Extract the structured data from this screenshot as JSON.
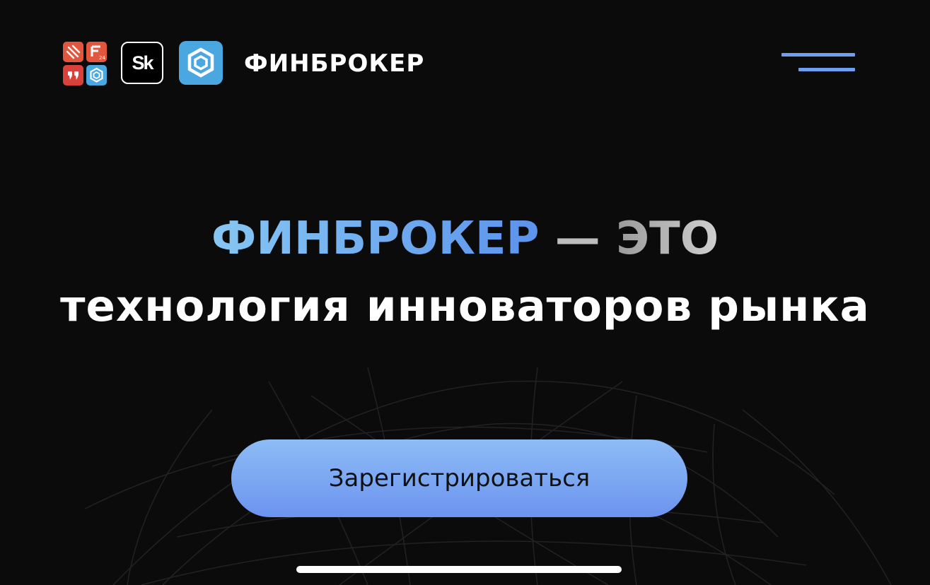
{
  "header": {
    "brand_name": "ФИНБРОКЕР",
    "partner_logos": [
      "partner-grid-logo",
      "sk-logo",
      "finbroker-logo"
    ],
    "sk_logo_text": "Sk",
    "menu_icon": "hamburger-icon"
  },
  "hero": {
    "brand_word": "ФИНБРОКЕР",
    "dash": "—",
    "eto": "ЭТО",
    "subtitle": "технология инноваторов рынка"
  },
  "cta": {
    "label": "Зарегистрироваться"
  },
  "colors": {
    "background": "#0b0b0c",
    "accent_blue": "#6f9df0",
    "accent_light_blue": "#86c7f3",
    "logo_blue": "#4aa7df",
    "logo_orange": "#e2563d",
    "logo_red": "#d9423c",
    "text_white": "#ffffff"
  }
}
